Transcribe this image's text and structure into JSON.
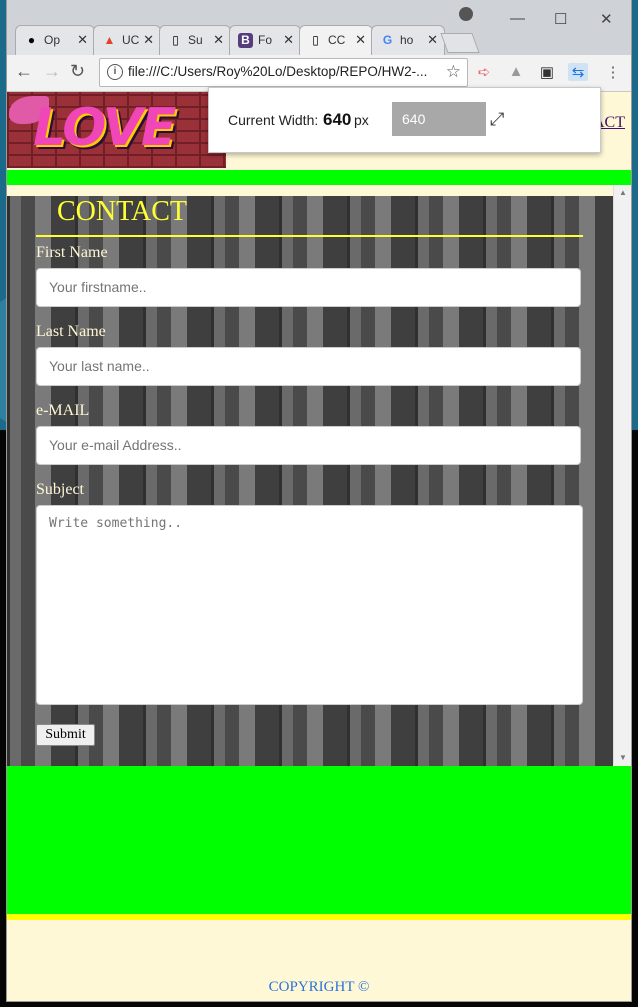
{
  "browser": {
    "tabs": [
      {
        "title": "Op",
        "favicon": "github-icon"
      },
      {
        "title": "UC",
        "favicon": "gitlab-icon"
      },
      {
        "title": "Su",
        "favicon": "page-icon"
      },
      {
        "title": "Fo",
        "favicon": "bootstrap-icon"
      },
      {
        "title": "CC",
        "favicon": "page-icon",
        "active": true
      },
      {
        "title": "ho",
        "favicon": "google-icon"
      }
    ],
    "url": "file:///C:/Users/Roy%20Lo/Desktop/REPO/HW2-..."
  },
  "width_popup": {
    "label": "Current Width:",
    "value": "640",
    "unit": "px",
    "input_value": "640"
  },
  "page": {
    "nav_link": "ACT",
    "form": {
      "title": "CONTACT",
      "first_name_label": "First Name",
      "first_name_placeholder": "Your firstname..",
      "last_name_label": "Last Name",
      "last_name_placeholder": "Your last name..",
      "email_label": "e-MAIL",
      "email_placeholder": "Your e-mail Address..",
      "subject_label": "Subject",
      "subject_placeholder": "Write something..",
      "submit_label": "Submit"
    },
    "footer": {
      "copyright": "COPYRIGHT ©"
    }
  },
  "colors": {
    "accent_green": "#00ff00",
    "title_yellow": "#ffff33",
    "page_bg": "#fff8d6"
  }
}
